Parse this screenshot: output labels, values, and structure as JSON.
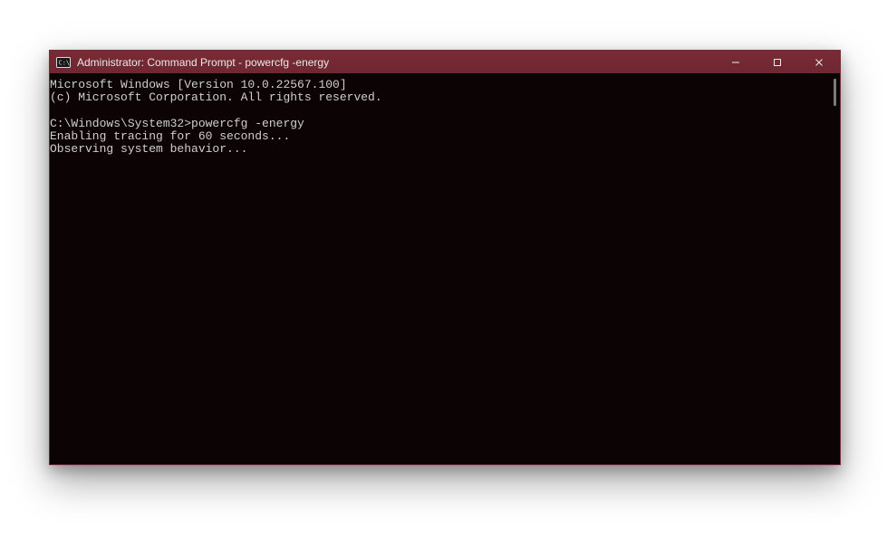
{
  "window": {
    "title": "Administrator: Command Prompt - powercfg  -energy",
    "icon": "cmd-icon"
  },
  "controls": {
    "minimize": "minimize",
    "maximize": "maximize",
    "close": "close"
  },
  "terminal": {
    "lines": [
      "Microsoft Windows [Version 10.0.22567.100]",
      "(c) Microsoft Corporation. All rights reserved.",
      "",
      "C:\\Windows\\System32>powercfg -energy",
      "Enabling tracing for 60 seconds...",
      "Observing system behavior..."
    ]
  }
}
